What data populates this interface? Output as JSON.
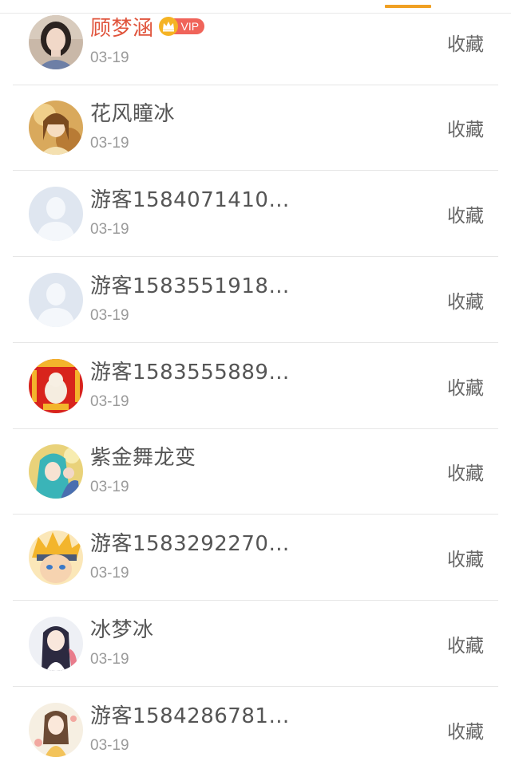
{
  "header": {
    "active_tab_color": "#f0a023"
  },
  "colors": {
    "vip_name": "#e0543c",
    "normal_name": "#555555",
    "date": "#9a9a9a",
    "action": "#666666",
    "vip_badge": "#f0645a",
    "vip_crown": "#f5b323"
  },
  "list": {
    "items": [
      {
        "name": "顾梦涵",
        "vip": true,
        "vip_label": "VIP",
        "date": "03-19",
        "action": "收藏",
        "avatar": "woman-photo-avatar"
      },
      {
        "name": "花风瞳冰",
        "vip": false,
        "date": "03-19",
        "action": "收藏",
        "avatar": "anime-girl-golden-avatar"
      },
      {
        "name": "游客1584071410…",
        "vip": false,
        "date": "03-19",
        "action": "收藏",
        "avatar": "default-user-avatar"
      },
      {
        "name": "游客1583551918…",
        "vip": false,
        "date": "03-19",
        "action": "收藏",
        "avatar": "default-user-avatar"
      },
      {
        "name": "游客1583555889…",
        "vip": false,
        "date": "03-19",
        "action": "收藏",
        "avatar": "festive-red-avatar"
      },
      {
        "name": "紫金舞龙变",
        "vip": false,
        "date": "03-19",
        "action": "收藏",
        "avatar": "anime-teal-hair-avatar"
      },
      {
        "name": "游客1583292270…",
        "vip": false,
        "date": "03-19",
        "action": "收藏",
        "avatar": "anime-blonde-ninja-avatar"
      },
      {
        "name": "冰梦冰",
        "vip": false,
        "date": "03-19",
        "action": "收藏",
        "avatar": "anime-dark-hair-girl-avatar"
      },
      {
        "name": "游客1584286781…",
        "vip": false,
        "date": "03-19",
        "action": "收藏",
        "avatar": "anime-pastel-girl-avatar"
      }
    ]
  }
}
